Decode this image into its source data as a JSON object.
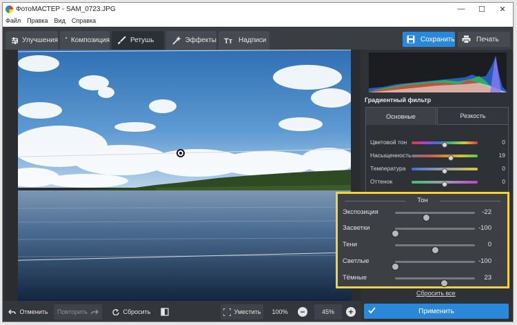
{
  "window": {
    "title": "ФотоМАСТЕР - SAM_0723.JPG",
    "controls": {
      "minimize": "—",
      "maximize": "☐",
      "close": "✕"
    }
  },
  "menu": [
    "Файл",
    "Правка",
    "Вид",
    "Справка"
  ],
  "tabs": [
    {
      "label": "Улучшения",
      "icon": "sliders-icon"
    },
    {
      "label": "Композиция",
      "icon": "crop-icon"
    },
    {
      "label": "Ретушь",
      "icon": "brush-icon"
    },
    {
      "label": "Эффекты",
      "icon": "magic-wand-icon"
    },
    {
      "label": "Надписи",
      "icon": "text-icon"
    }
  ],
  "actions": {
    "save": "Сохранить",
    "print": "Печать"
  },
  "panel": {
    "title": "Градиентный фильтр",
    "subtabs": [
      "Основные",
      "Резкость"
    ],
    "color_sliders": [
      {
        "label": "Цветовой тон",
        "value": "0",
        "level": 0.5
      },
      {
        "label": "Насыщенность",
        "value": "19",
        "level": 0.59
      },
      {
        "label": "Температура",
        "value": "0",
        "level": 0.5
      },
      {
        "label": "Оттенок",
        "value": "0",
        "level": 0.5
      }
    ],
    "reset_all": "Сбросить все",
    "apply": "Применить"
  },
  "tone": {
    "title": "Тон",
    "sliders": [
      {
        "label": "Экспозиция",
        "value": "-22",
        "level": 0.39
      },
      {
        "label": "Засветки",
        "value": "-100",
        "level": 0.0
      },
      {
        "label": "Тени",
        "value": "0",
        "level": 0.5
      },
      {
        "label": "Светлые",
        "value": "-100",
        "level": 0.0
      },
      {
        "label": "Тёмные",
        "value": "23",
        "level": 0.615
      }
    ]
  },
  "bottom": {
    "undo": "Отменить",
    "redo": "Повторить",
    "reset": "Сбросить",
    "fit": "Уместить",
    "zoom100": "100%",
    "zoom_minus": "−",
    "zoom_value": "45%",
    "zoom_plus": "+"
  },
  "colors": {
    "accent": "#2b87d8",
    "highlight": "#f2d33f",
    "panel": "#2e3136"
  }
}
